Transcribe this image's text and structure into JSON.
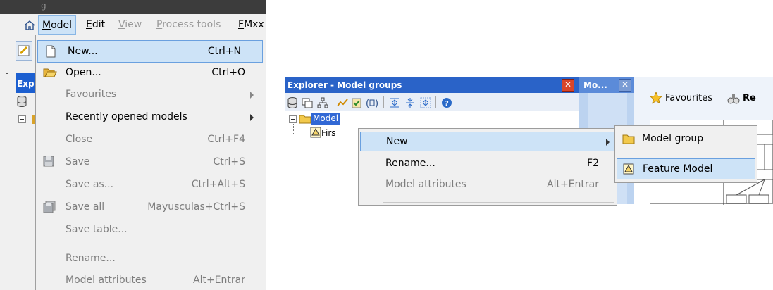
{
  "left_window": {
    "title_fragment": "g",
    "menubar": {
      "items": [
        {
          "label": "Model",
          "selected": true,
          "disabled": false
        },
        {
          "label": "Edit",
          "selected": false,
          "disabled": false
        },
        {
          "label": "View",
          "selected": false,
          "disabled": true
        },
        {
          "label": "Process tools",
          "selected": false,
          "disabled": true
        },
        {
          "label": "FMxx",
          "selected": false,
          "disabled": false
        }
      ]
    },
    "explorer_tab_label": "Exp",
    "model_menu": {
      "items": [
        {
          "label": "New...",
          "shortcut": "Ctrl+N",
          "icon": "new-document-icon",
          "selected": true,
          "disabled": false
        },
        {
          "label": "Open...",
          "shortcut": "Ctrl+O",
          "icon": "open-folder-icon",
          "selected": false,
          "disabled": false
        },
        {
          "label": "Favourites",
          "shortcut": "",
          "icon": "",
          "submenu": true,
          "disabled": true
        },
        {
          "label": "Recently opened models",
          "shortcut": "",
          "icon": "",
          "submenu": true,
          "disabled": false
        },
        {
          "label": "Close",
          "shortcut": "Ctrl+F4",
          "icon": "",
          "disabled": true
        },
        {
          "label": "Save",
          "shortcut": "Ctrl+S",
          "icon": "save-icon",
          "disabled": true
        },
        {
          "label": "Save as...",
          "shortcut": "Ctrl+Alt+S",
          "icon": "",
          "disabled": true
        },
        {
          "label": "Save all",
          "shortcut": "Mayusculas+Ctrl+S",
          "icon": "save-all-icon",
          "disabled": true
        },
        {
          "label": "Save table...",
          "shortcut": "",
          "icon": "",
          "disabled": true
        },
        {
          "label": "Rename...",
          "shortcut": "",
          "icon": "",
          "disabled": true
        },
        {
          "label": "Model attributes",
          "shortcut": "Alt+Entrar",
          "icon": "",
          "disabled": true
        }
      ]
    }
  },
  "right_window": {
    "explorer_title": "Explorer - Model groups",
    "second_panel_title": "Mo...",
    "toolbar_buttons": [
      "Favourites",
      "Re"
    ],
    "tree": {
      "root_label": "Model",
      "child_label": "Firs"
    },
    "context_menu": {
      "items": [
        {
          "label": "New",
          "shortcut": "",
          "submenu": true,
          "selected": true,
          "disabled": false
        },
        {
          "label": "Rename...",
          "shortcut": "F2",
          "selected": false,
          "disabled": false
        },
        {
          "label": "Model attributes",
          "shortcut": "Alt+Entrar",
          "selected": false,
          "disabled": true
        }
      ]
    },
    "new_submenu": {
      "items": [
        {
          "label": "Model group",
          "icon": "folder-icon",
          "selected": false
        },
        {
          "label": "Feature Model",
          "icon": "feature-model-icon",
          "selected": true
        }
      ]
    }
  },
  "colors": {
    "title_blue": "#2a63c8",
    "selection_fill": "#cde3f7",
    "selection_border": "#6aa0df",
    "menu_bg": "#f0f0f0",
    "disabled_text": "#7d7d7d"
  }
}
